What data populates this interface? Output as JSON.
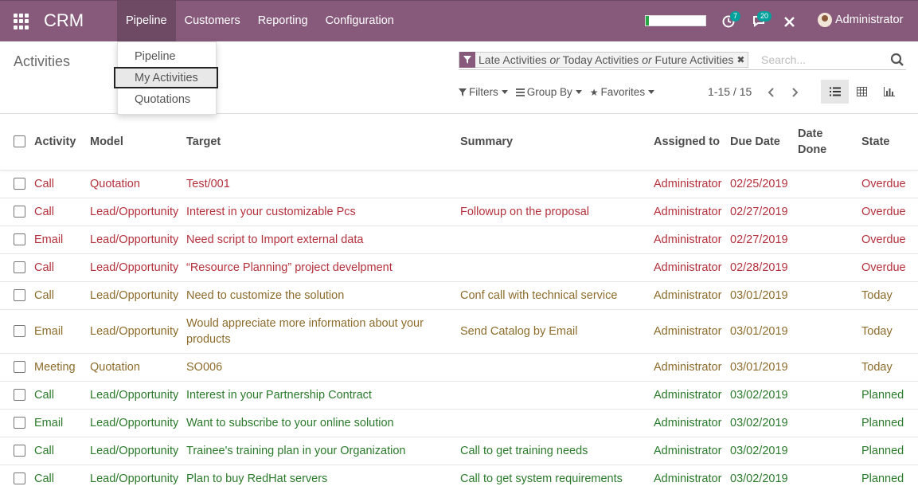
{
  "navbar": {
    "brand": "CRM",
    "menu": [
      "Pipeline",
      "Customers",
      "Reporting",
      "Configuration"
    ],
    "activity_badge": "7",
    "messages_badge": "20",
    "user": "Administrator"
  },
  "page_title": "Activities",
  "dropdown": [
    "Pipeline",
    "My Activities",
    "Quotations"
  ],
  "search": {
    "facet_values": [
      "Late Activities",
      "Today Activities",
      "Future Activities"
    ],
    "facet_separator": "or",
    "placeholder": "Search..."
  },
  "filters": {
    "filters_label": "Filters",
    "groupby_label": "Group By",
    "favorites_label": "Favorites"
  },
  "pager": "1-15 / 15",
  "table": {
    "headers": [
      "Activity",
      "Model",
      "Target",
      "Summary",
      "Assigned to",
      "Due Date",
      "Date Done",
      "State"
    ],
    "rows": [
      {
        "activity": "Call",
        "model": "Quotation",
        "target": "Test/001",
        "summary": "",
        "assigned": "Administrator",
        "due": "02/25/2019",
        "done": "",
        "state": "Overdue"
      },
      {
        "activity": "Call",
        "model": "Lead/Opportunity",
        "target": "Interest in your customizable Pcs",
        "summary": "Followup on the proposal",
        "assigned": "Administrator",
        "due": "02/27/2019",
        "done": "",
        "state": "Overdue"
      },
      {
        "activity": "Email",
        "model": "Lead/Opportunity",
        "target": "Need script to Import external data",
        "summary": "",
        "assigned": "Administrator",
        "due": "02/27/2019",
        "done": "",
        "state": "Overdue"
      },
      {
        "activity": "Call",
        "model": "Lead/Opportunity",
        "target": "“Resource Planning” project develpment",
        "summary": "",
        "assigned": "Administrator",
        "due": "02/28/2019",
        "done": "",
        "state": "Overdue"
      },
      {
        "activity": "Call",
        "model": "Lead/Opportunity",
        "target": "Need to customize the solution",
        "summary": "Conf call with technical service",
        "assigned": "Administrator",
        "due": "03/01/2019",
        "done": "",
        "state": "Today"
      },
      {
        "activity": "Email",
        "model": "Lead/Opportunity",
        "target": "Would appreciate more information about your products",
        "summary": "Send Catalog by Email",
        "assigned": "Administrator",
        "due": "03/01/2019",
        "done": "",
        "state": "Today"
      },
      {
        "activity": "Meeting",
        "model": "Quotation",
        "target": "SO006",
        "summary": "",
        "assigned": "Administrator",
        "due": "03/01/2019",
        "done": "",
        "state": "Today"
      },
      {
        "activity": "Call",
        "model": "Lead/Opportunity",
        "target": "Interest in your Partnership Contract",
        "summary": "",
        "assigned": "Administrator",
        "due": "03/02/2019",
        "done": "",
        "state": "Planned"
      },
      {
        "activity": "Email",
        "model": "Lead/Opportunity",
        "target": "Want to subscribe to your online solution",
        "summary": "",
        "assigned": "Administrator",
        "due": "03/02/2019",
        "done": "",
        "state": "Planned"
      },
      {
        "activity": "Call",
        "model": "Lead/Opportunity",
        "target": "Trainee's training plan in your Organization",
        "summary": "Call to get training needs",
        "assigned": "Administrator",
        "due": "03/02/2019",
        "done": "",
        "state": "Planned"
      },
      {
        "activity": "Call",
        "model": "Lead/Opportunity",
        "target": "Plan to buy RedHat servers",
        "summary": "Call to get system requirements",
        "assigned": "Administrator",
        "due": "03/02/2019",
        "done": "",
        "state": "Planned"
      }
    ]
  },
  "colors": {
    "navbar": "#875a7b",
    "overdue": "#b4313c",
    "today": "#8d6c2c",
    "planned": "#2b7a2b"
  }
}
